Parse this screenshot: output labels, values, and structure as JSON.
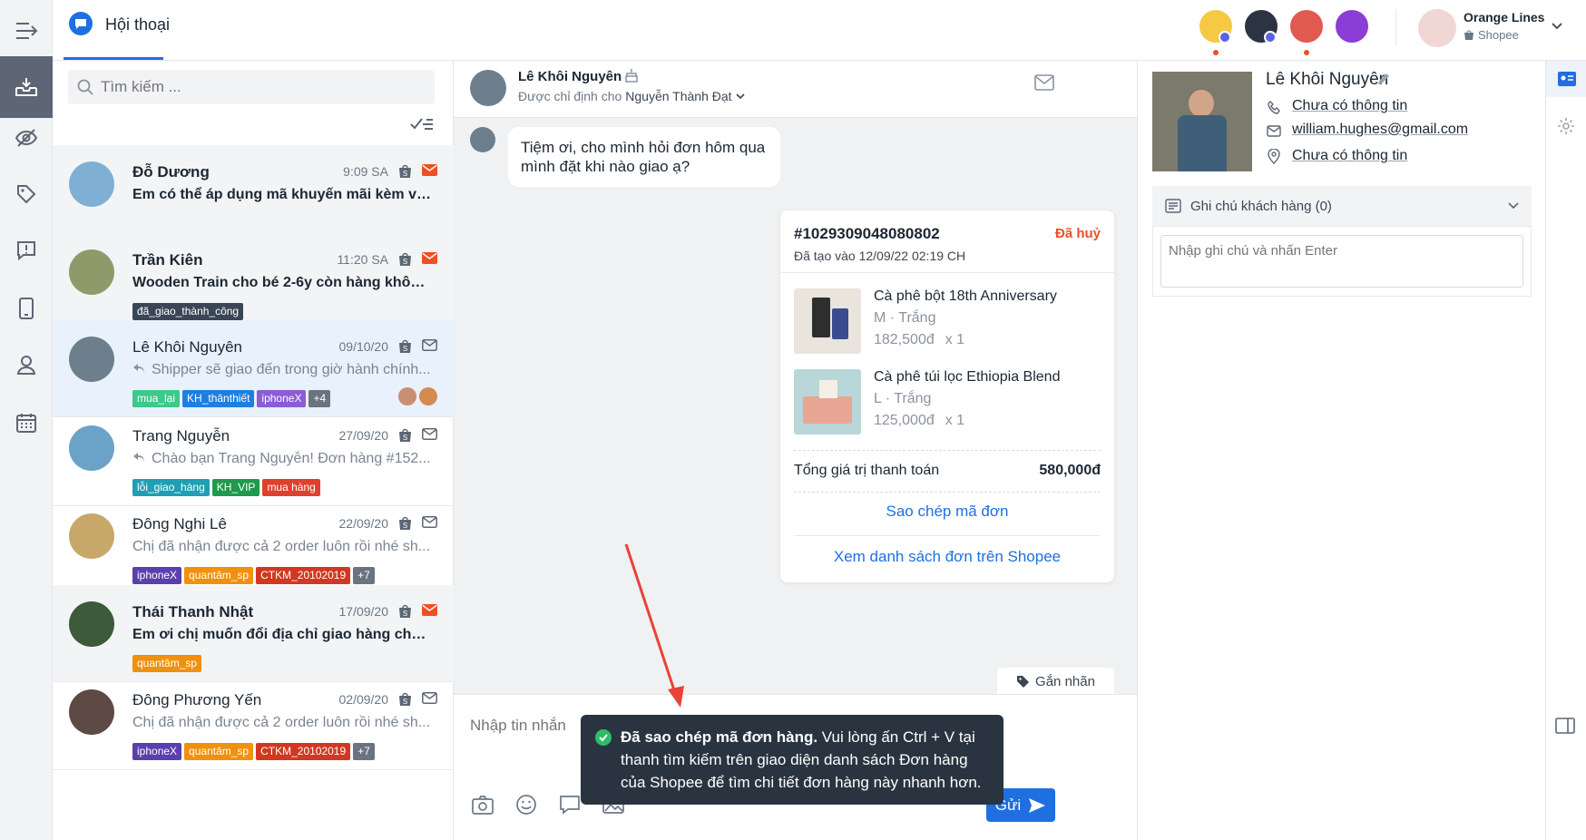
{
  "header": {
    "title": "Hội thoại"
  },
  "account": {
    "name": "Orange Lines",
    "platform": "Shopee"
  },
  "search": {
    "placeholder": "Tìm kiếm ..."
  },
  "conversations": [
    {
      "name": "Đỗ Dương",
      "time": "9:09 SA",
      "preview": "Em có thể áp dụng mã khuyến mãi kèm với...",
      "unread": true,
      "tags": [],
      "avatar_color": "#7fb0d4"
    },
    {
      "name": "Trần Kiên",
      "time": "11:20 SA",
      "preview": "Wooden Train cho bé 2-6y còn hàng không...",
      "unread": true,
      "tags": [
        {
          "label": "đã_giao_thành_công",
          "color": "#3a4556"
        }
      ],
      "avatar_color": "#8e9a6a"
    },
    {
      "name": "Lê Khôi Nguyên",
      "time": "09/10/20",
      "preview": "Shipper sẽ giao đến trong giờ hành chính...",
      "unread": false,
      "selected": true,
      "reply": true,
      "tags": [
        {
          "label": "mua_lại",
          "color": "#3cc98a"
        },
        {
          "label": "KH_thânthiết",
          "color": "#1f7ee0"
        },
        {
          "label": "iphoneX",
          "color": "#8b5cd6"
        },
        {
          "label": "+4",
          "color": "#6b7380"
        }
      ],
      "avatar_color": "#6d7f8c"
    },
    {
      "name": "Trang Nguyễn",
      "time": "27/09/20",
      "preview": "Chào bạn Trang Nguyễn! Đơn hàng #152...",
      "unread": false,
      "reply": true,
      "tags": [
        {
          "label": "lỗi_giao_hàng",
          "color": "#1f9fb3"
        },
        {
          "label": "KH_VIP",
          "color": "#1e9a4c"
        },
        {
          "label": "mua hàng",
          "color": "#e0412c"
        }
      ],
      "avatar_color": "#6aa2c8"
    },
    {
      "name": "Đông Nghi Lê",
      "time": "22/09/20",
      "preview": "Chị đã nhận được cả 2 order luôn rồi nhé sh...",
      "unread": false,
      "tags": [
        {
          "label": "iphoneX",
          "color": "#5b3fb0"
        },
        {
          "label": "quantâm_sp",
          "color": "#f0900c"
        },
        {
          "label": "CTKM_20102019",
          "color": "#d2381f"
        },
        {
          "label": "+7",
          "color": "#6b7380"
        }
      ],
      "avatar_color": "#c7a86a"
    },
    {
      "name": "Thái Thanh Nhật",
      "time": "17/09/20",
      "preview": "Em ơi chị muốn đổi địa chỉ giao hàng cho đơ...",
      "unread": true,
      "tags": [
        {
          "label": "quantâm_sp",
          "color": "#f0900c"
        }
      ],
      "avatar_color": "#3d5a3a"
    },
    {
      "name": "Đông Phương Yến",
      "time": "02/09/20",
      "preview": "Chị đã nhận được cả 2 order luôn rồi nhé sh...",
      "unread": false,
      "tags": [
        {
          "label": "iphoneX",
          "color": "#5b3fb0"
        },
        {
          "label": "quantâm_sp",
          "color": "#f0900c"
        },
        {
          "label": "CTKM_20102019",
          "color": "#d2381f"
        },
        {
          "label": "+7",
          "color": "#6b7380"
        }
      ],
      "avatar_color": "#5e4a45"
    }
  ],
  "chat": {
    "contact_name": "Lê Khôi Nguyên",
    "assigned_prefix": "Được chỉ định cho",
    "assigned_to": "Nguyễn Thành Đạt",
    "incoming_message": "Tiệm ơi, cho mình hỏi đơn hôm qua mình đặt khi nào giao ạ?",
    "order": {
      "id": "#1029309048080802",
      "status": "Đã huỷ",
      "created": "Đã tạo vào 12/09/22 02:19 CH",
      "items": [
        {
          "name": "Cà phê bột 18th Anniversary",
          "variant": "M · Trắng",
          "price": "182,500đ",
          "qty": "x  1"
        },
        {
          "name": "Cà phê túi lọc Ethiopia Blend",
          "variant": "L · Trắng",
          "price": "125,000đ",
          "qty": "x  1"
        }
      ],
      "total_label": "Tổng giá trị thanh toán",
      "total": "580,000đ",
      "copy_action": "Sao chép mã đơn",
      "view_action": "Xem danh sách đơn trên Shopee"
    },
    "tag_button": "Gắn nhãn",
    "input_placeholder": "Nhập tin nhắn",
    "send_label": "Gửi"
  },
  "toast": {
    "bold": "Đã sao chép mã đơn hàng.",
    "text": " Vui lòng ấn Ctrl + V tại thanh tìm kiếm trên giao diện danh sách Đơn hàng của Shopee để tìm chi tiết đơn hàng này nhanh hơn."
  },
  "profile": {
    "name": "Lê Khôi Nguyên",
    "phone": "Chưa có thông tin",
    "email": "william.hughes@gmail.com",
    "address": "Chưa có thông tin",
    "notes_title": "Ghi chú khách hàng (0)",
    "notes_placeholder": "Nhập ghi chú và nhấn Enter"
  },
  "colors": {
    "accent": "#1f6fe0",
    "danger": "#f04e23",
    "toast_bg": "#2a3441"
  }
}
